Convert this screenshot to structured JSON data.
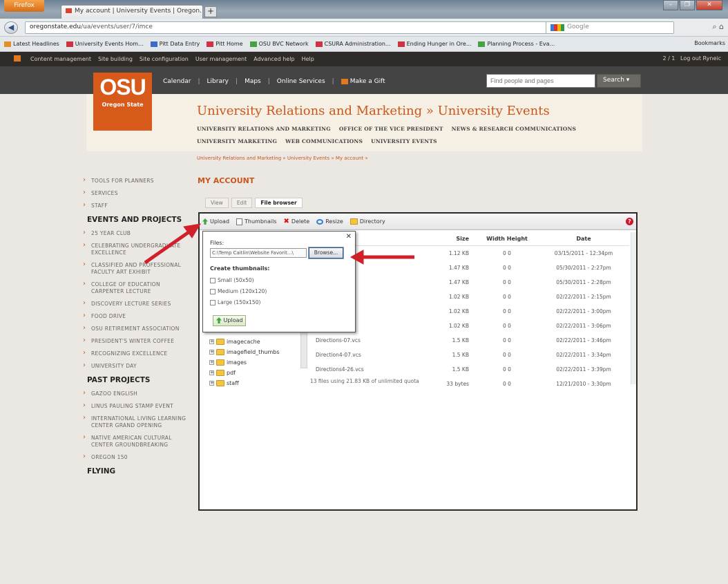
{
  "browser": {
    "firefox_label": "Firefox",
    "tab_title": "My account | University Events | Oregon...",
    "new_tab": "+",
    "url_domain": "oregonstate.edu",
    "url_path": "/ua/events/user/7/imce",
    "search_engine": "Google",
    "window_controls": [
      "–",
      "❐",
      "✕"
    ],
    "bookmarks": [
      {
        "label": "Latest Headlines",
        "icon": "rss-icon"
      },
      {
        "label": "University Events Hom...",
        "icon": "page-icon"
      },
      {
        "label": "Pitt Data Entry",
        "icon": "chart-icon"
      },
      {
        "label": "Pitt Home",
        "icon": "page-icon"
      },
      {
        "label": "OSU BVC Network",
        "icon": "network-icon"
      },
      {
        "label": "CSURA Administration...",
        "icon": "page-icon"
      },
      {
        "label": "Ending Hunger in Ore...",
        "icon": "page-icon"
      },
      {
        "label": "Planning Process - Eva...",
        "icon": "page-icon"
      }
    ],
    "bookmarks_right": "Bookmarks"
  },
  "admin_bar": {
    "items": [
      "Content management",
      "Site building",
      "Site configuration",
      "User management",
      "Advanced help",
      "Help"
    ],
    "right_count": "2 / 1",
    "logout": "Log out Ryneic"
  },
  "site": {
    "logo_big": "OSU",
    "logo_small": "Oregon State",
    "top_nav": [
      "Calendar",
      "Library",
      "Maps",
      "Online Services",
      "Make a Gift"
    ],
    "search_placeholder": "Find people and pages",
    "search_button": "Search",
    "unit_name": "University Relations and Marketing » University Events",
    "sub_nav_row1": [
      "UNIVERSITY RELATIONS AND MARKETING",
      "OFFICE OF THE VICE PRESIDENT",
      "NEWS & RESEARCH COMMUNICATIONS"
    ],
    "sub_nav_row2": [
      "UNIVERSITY MARKETING",
      "WEB COMMUNICATIONS",
      "UNIVERSITY EVENTS"
    ],
    "breadcrumb": "University Relations and Marketing » University Events » My account »"
  },
  "sidebar": {
    "top_items": [
      "TOOLS FOR PLANNERS",
      "SERVICES",
      "STAFF"
    ],
    "heading1": "EVENTS AND PROJECTS",
    "events": [
      "25 YEAR CLUB",
      "CELEBRATING UNDERGRADUATE EXCELLENCE",
      "CLASSIFIED AND PROFESSIONAL FACULTY ART EXHIBIT",
      "COLLEGE OF EDUCATION CARPENTER LECTURE",
      "DISCOVERY LECTURE SERIES",
      "FOOD DRIVE",
      "OSU RETIREMENT ASSOCIATION",
      "PRESIDENT'S WINTER COFFEE",
      "RECOGNIZING EXCELLENCE",
      "UNIVERSITY DAY"
    ],
    "heading2": "PAST PROJECTS",
    "past": [
      "GAZOO ENGLISH",
      "LINUS PAULING STAMP EVENT",
      "INTERNATIONAL LIVING LEARNING CENTER GRAND OPENING",
      "NATIVE AMERICAN CULTURAL CENTER GROUNDBREAKING",
      "OREGON 150"
    ],
    "heading3": "FLYING"
  },
  "main": {
    "title": "MY ACCOUNT",
    "tabs": [
      "View",
      "Edit",
      "File browser"
    ]
  },
  "file_browser": {
    "toolbar": [
      "Upload",
      "Thumbnails",
      "Delete",
      "Resize",
      "Directory"
    ],
    "help": "?",
    "popup": {
      "close": "✕",
      "files_label": "Files:",
      "file_value": "C:\\Temp Caitlin\\Website Favorit...\\",
      "browse": "Browse...",
      "create_thumbs": "Create thumbnails:",
      "options": [
        "Small (50x50)",
        "Medium (120x120)",
        "Large (150x150)"
      ],
      "upload_button": "Upload"
    },
    "tree": [
      {
        "pm": "+",
        "name": "imagecache"
      },
      {
        "pm": "+",
        "name": "imagefield_thumbs"
      },
      {
        "pm": "+",
        "name": "images"
      },
      {
        "pm": "+",
        "name": "pdf"
      },
      {
        "pm": "+",
        "name": "staff"
      }
    ],
    "columns": {
      "size": "Size",
      "width": "Width",
      "height": "Height",
      "date": "Date"
    },
    "rows": [
      {
        "name": "",
        "size": "1.12 KB",
        "wh": "0 0",
        "date": "03/15/2011 - 12:34pm"
      },
      {
        "name": "",
        "size": "1.47 KB",
        "wh": "0 0",
        "date": "05/30/2011 - 2:27pm"
      },
      {
        "name": "",
        "size": "1.47 KB",
        "wh": "0 0",
        "date": "05/30/2011 - 2:28pm"
      },
      {
        "name": "",
        "size": "1.02 KB",
        "wh": "0 0",
        "date": "02/22/2011 - 2:15pm"
      },
      {
        "name": "",
        "size": "1.02 KB",
        "wh": "0 0",
        "date": "02/22/2011 - 3:00pm"
      },
      {
        "name": "",
        "size": "1.02 KB",
        "wh": "0 0",
        "date": "02/22/2011 - 3:06pm"
      },
      {
        "name": "Directions-07.vcs",
        "size": "1.5 KB",
        "wh": "0 0",
        "date": "02/22/2011 - 3:46pm"
      },
      {
        "name": "Direction4-07.vcs",
        "size": "1.5 KB",
        "wh": "0 0",
        "date": "02/22/2011 - 3:34pm"
      },
      {
        "name": "Directions4-26.vcs",
        "size": "1.5 KB",
        "wh": "0 0",
        "date": "02/22/2011 - 3:39pm"
      },
      {
        "name": "",
        "size": "33 bytes",
        "wh": "0 0",
        "date": "12/21/2010 - 3:30pm"
      }
    ],
    "status": "13 files using 21.83 KB of unlimited quota"
  }
}
